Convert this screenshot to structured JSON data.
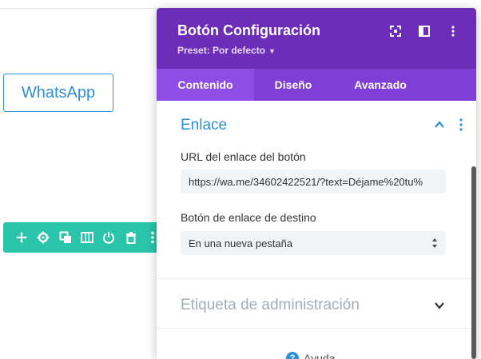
{
  "canvas": {
    "whatsapp_button_label": "WhatsApp"
  },
  "row_toolbar": {
    "icons": [
      "move-icon",
      "settings-icon",
      "duplicate-icon",
      "columns-icon",
      "power-icon",
      "trash-icon",
      "more-icon"
    ]
  },
  "panel": {
    "title": "Botón Configuración",
    "preset": "Preset: Por defecto",
    "header_icons": [
      "fullscreen-icon",
      "sidebar-icon",
      "more-icon"
    ],
    "tabs": [
      {
        "label": "Contenido",
        "active": true
      },
      {
        "label": "Diseño",
        "active": false
      },
      {
        "label": "Avanzado",
        "active": false
      }
    ],
    "section_link": {
      "title": "Enlace",
      "url_label": "URL del enlace del botón",
      "url_value": "https://wa.me/34602422521/?text=Déjame%20tu%",
      "target_label": "Botón de enlace de destino",
      "target_value": "En una nueva pestaña"
    },
    "section_admin": {
      "title": "Etiqueta de administración"
    },
    "help_label": "Ayuda"
  },
  "colors": {
    "header": "#6c2eb9",
    "tabs": "#7f3fd6",
    "active_tab": "#8e4ee6",
    "accent_blue": "#2d8fd5",
    "toolbar_green": "#29c4a9"
  }
}
